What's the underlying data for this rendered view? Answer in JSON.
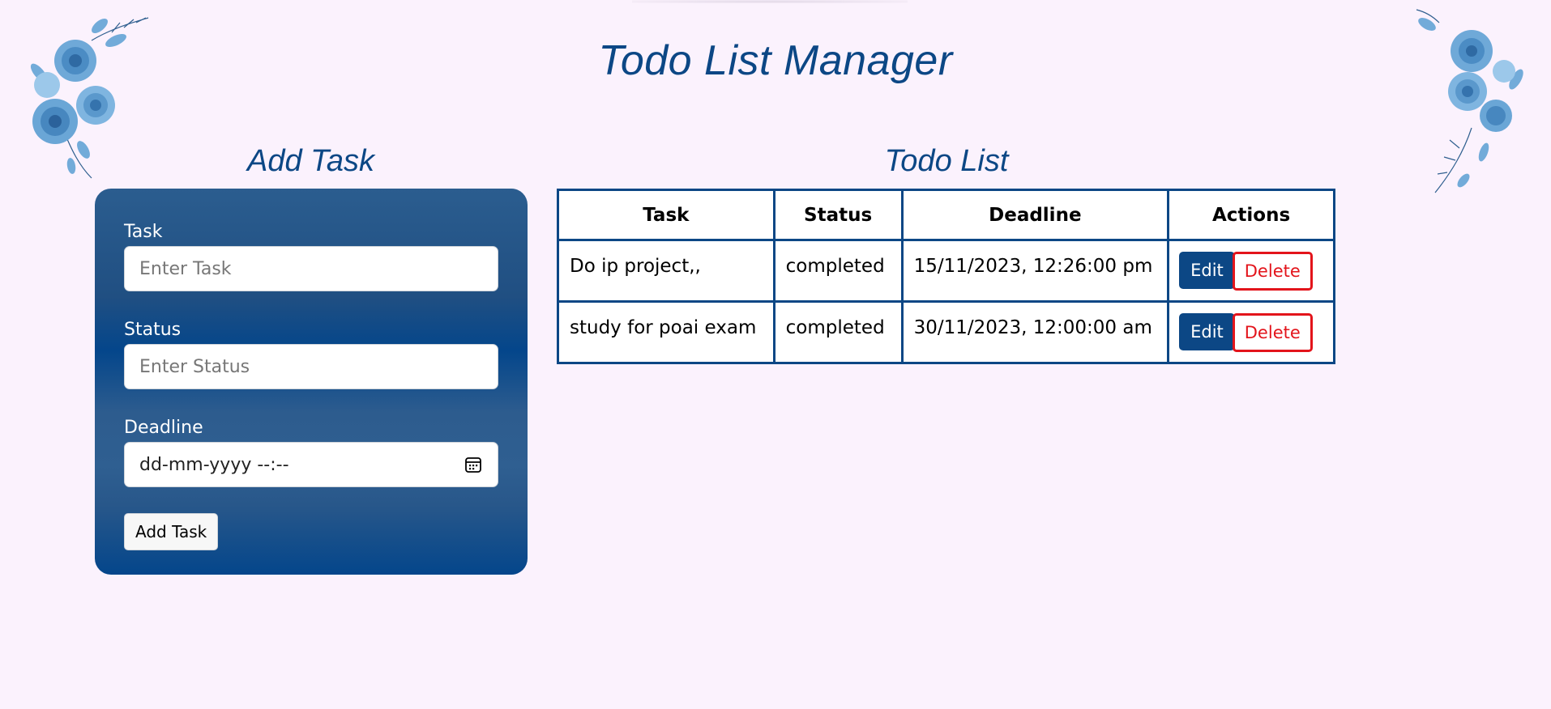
{
  "header": {
    "title": "Todo List Manager"
  },
  "add_task": {
    "heading": "Add Task",
    "task_label": "Task",
    "task_placeholder": "Enter Task",
    "task_value": "",
    "status_label": "Status",
    "status_placeholder": "Enter Status",
    "status_value": "",
    "deadline_label": "Deadline",
    "deadline_placeholder": "dd-mm-yyyy --:--",
    "submit_label": "Add Task"
  },
  "todo_list": {
    "heading": "Todo List",
    "columns": [
      "Task",
      "Status",
      "Deadline",
      "Actions"
    ],
    "rows": [
      {
        "task": "Do ip project,,",
        "status": "completed",
        "deadline": "15/11/2023, 12:26:00 pm",
        "edit_label": "Edit",
        "delete_label": "Delete"
      },
      {
        "task": "study for poai exam",
        "status": "completed",
        "deadline": "30/11/2023, 12:00:00 am",
        "edit_label": "Edit",
        "delete_label": "Delete"
      }
    ]
  },
  "icons": {
    "calendar": "calendar-icon",
    "decoration_left": "floral-decoration-icon",
    "decoration_right": "floral-decoration-icon"
  },
  "colors": {
    "background": "#fbf2fd",
    "accent": "#0c4785",
    "danger": "#e3141b",
    "white": "#ffffff"
  }
}
